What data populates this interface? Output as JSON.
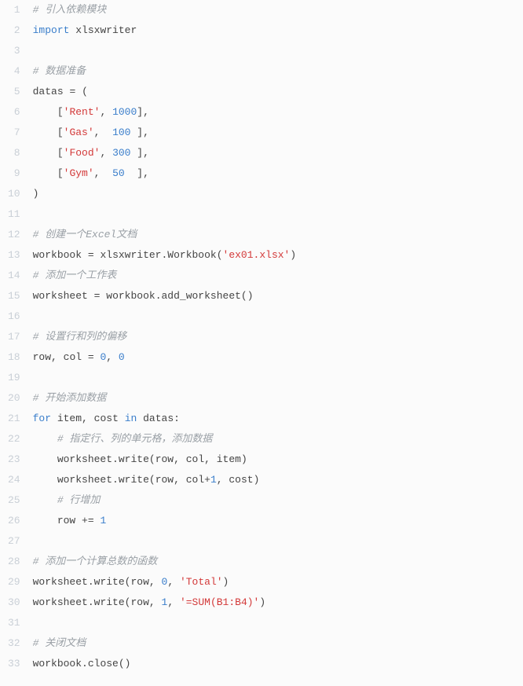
{
  "code": {
    "lines": [
      {
        "n": "1",
        "tokens": [
          {
            "cls": "tok-comment",
            "t": "# 引入依赖模块"
          }
        ]
      },
      {
        "n": "2",
        "tokens": [
          {
            "cls": "tok-keyword",
            "t": "import"
          },
          {
            "cls": "tok-default",
            "t": " "
          },
          {
            "cls": "tok-name",
            "t": "xlsxwriter"
          }
        ]
      },
      {
        "n": "3",
        "tokens": []
      },
      {
        "n": "4",
        "tokens": [
          {
            "cls": "tok-comment",
            "t": "# 数据准备"
          }
        ]
      },
      {
        "n": "5",
        "tokens": [
          {
            "cls": "tok-name",
            "t": "datas"
          },
          {
            "cls": "tok-default",
            "t": " "
          },
          {
            "cls": "tok-punc",
            "t": "="
          },
          {
            "cls": "tok-default",
            "t": " "
          },
          {
            "cls": "tok-punc",
            "t": "("
          }
        ]
      },
      {
        "n": "6",
        "tokens": [
          {
            "cls": "tok-default",
            "t": "    "
          },
          {
            "cls": "tok-punc",
            "t": "["
          },
          {
            "cls": "tok-string",
            "t": "'Rent'"
          },
          {
            "cls": "tok-punc",
            "t": ","
          },
          {
            "cls": "tok-default",
            "t": " "
          },
          {
            "cls": "tok-number",
            "t": "1000"
          },
          {
            "cls": "tok-punc",
            "t": "]"
          },
          {
            "cls": "tok-punc",
            "t": ","
          }
        ]
      },
      {
        "n": "7",
        "tokens": [
          {
            "cls": "tok-default",
            "t": "    "
          },
          {
            "cls": "tok-punc",
            "t": "["
          },
          {
            "cls": "tok-string",
            "t": "'Gas'"
          },
          {
            "cls": "tok-punc",
            "t": ","
          },
          {
            "cls": "tok-default",
            "t": "  "
          },
          {
            "cls": "tok-number",
            "t": "100"
          },
          {
            "cls": "tok-default",
            "t": " "
          },
          {
            "cls": "tok-punc",
            "t": "]"
          },
          {
            "cls": "tok-punc",
            "t": ","
          }
        ]
      },
      {
        "n": "8",
        "tokens": [
          {
            "cls": "tok-default",
            "t": "    "
          },
          {
            "cls": "tok-punc",
            "t": "["
          },
          {
            "cls": "tok-string",
            "t": "'Food'"
          },
          {
            "cls": "tok-punc",
            "t": ","
          },
          {
            "cls": "tok-default",
            "t": " "
          },
          {
            "cls": "tok-number",
            "t": "300"
          },
          {
            "cls": "tok-default",
            "t": " "
          },
          {
            "cls": "tok-punc",
            "t": "]"
          },
          {
            "cls": "tok-punc",
            "t": ","
          }
        ]
      },
      {
        "n": "9",
        "tokens": [
          {
            "cls": "tok-default",
            "t": "    "
          },
          {
            "cls": "tok-punc",
            "t": "["
          },
          {
            "cls": "tok-string",
            "t": "'Gym'"
          },
          {
            "cls": "tok-punc",
            "t": ","
          },
          {
            "cls": "tok-default",
            "t": "  "
          },
          {
            "cls": "tok-number",
            "t": "50"
          },
          {
            "cls": "tok-default",
            "t": "  "
          },
          {
            "cls": "tok-punc",
            "t": "]"
          },
          {
            "cls": "tok-punc",
            "t": ","
          }
        ]
      },
      {
        "n": "10",
        "tokens": [
          {
            "cls": "tok-punc",
            "t": ")"
          }
        ]
      },
      {
        "n": "11",
        "tokens": []
      },
      {
        "n": "12",
        "tokens": [
          {
            "cls": "tok-comment",
            "t": "# 创建一个Excel文档"
          }
        ]
      },
      {
        "n": "13",
        "tokens": [
          {
            "cls": "tok-name",
            "t": "workbook"
          },
          {
            "cls": "tok-default",
            "t": " "
          },
          {
            "cls": "tok-punc",
            "t": "="
          },
          {
            "cls": "tok-default",
            "t": " "
          },
          {
            "cls": "tok-name",
            "t": "xlsxwriter"
          },
          {
            "cls": "tok-punc",
            "t": "."
          },
          {
            "cls": "tok-name",
            "t": "Workbook"
          },
          {
            "cls": "tok-punc",
            "t": "("
          },
          {
            "cls": "tok-string",
            "t": "'ex01.xlsx'"
          },
          {
            "cls": "tok-punc",
            "t": ")"
          }
        ]
      },
      {
        "n": "14",
        "tokens": [
          {
            "cls": "tok-comment",
            "t": "# 添加一个工作表"
          }
        ]
      },
      {
        "n": "15",
        "tokens": [
          {
            "cls": "tok-name",
            "t": "worksheet"
          },
          {
            "cls": "tok-default",
            "t": " "
          },
          {
            "cls": "tok-punc",
            "t": "="
          },
          {
            "cls": "tok-default",
            "t": " "
          },
          {
            "cls": "tok-name",
            "t": "workbook"
          },
          {
            "cls": "tok-punc",
            "t": "."
          },
          {
            "cls": "tok-name",
            "t": "add_worksheet"
          },
          {
            "cls": "tok-punc",
            "t": "()"
          }
        ]
      },
      {
        "n": "16",
        "tokens": []
      },
      {
        "n": "17",
        "tokens": [
          {
            "cls": "tok-comment",
            "t": "# 设置行和列的偏移"
          }
        ]
      },
      {
        "n": "18",
        "tokens": [
          {
            "cls": "tok-name",
            "t": "row"
          },
          {
            "cls": "tok-punc",
            "t": ","
          },
          {
            "cls": "tok-default",
            "t": " "
          },
          {
            "cls": "tok-name",
            "t": "col"
          },
          {
            "cls": "tok-default",
            "t": " "
          },
          {
            "cls": "tok-punc",
            "t": "="
          },
          {
            "cls": "tok-default",
            "t": " "
          },
          {
            "cls": "tok-number",
            "t": "0"
          },
          {
            "cls": "tok-punc",
            "t": ","
          },
          {
            "cls": "tok-default",
            "t": " "
          },
          {
            "cls": "tok-number",
            "t": "0"
          }
        ]
      },
      {
        "n": "19",
        "tokens": []
      },
      {
        "n": "20",
        "tokens": [
          {
            "cls": "tok-comment",
            "t": "# 开始添加数据"
          }
        ]
      },
      {
        "n": "21",
        "tokens": [
          {
            "cls": "tok-keyword",
            "t": "for"
          },
          {
            "cls": "tok-default",
            "t": " "
          },
          {
            "cls": "tok-name",
            "t": "item"
          },
          {
            "cls": "tok-punc",
            "t": ","
          },
          {
            "cls": "tok-default",
            "t": " "
          },
          {
            "cls": "tok-name",
            "t": "cost"
          },
          {
            "cls": "tok-default",
            "t": " "
          },
          {
            "cls": "tok-keyword",
            "t": "in"
          },
          {
            "cls": "tok-default",
            "t": " "
          },
          {
            "cls": "tok-name",
            "t": "datas"
          },
          {
            "cls": "tok-punc",
            "t": ":"
          }
        ]
      },
      {
        "n": "22",
        "tokens": [
          {
            "cls": "tok-default",
            "t": "    "
          },
          {
            "cls": "tok-comment",
            "t": "# 指定行、列的单元格，添加数据"
          }
        ]
      },
      {
        "n": "23",
        "tokens": [
          {
            "cls": "tok-default",
            "t": "    "
          },
          {
            "cls": "tok-name",
            "t": "worksheet"
          },
          {
            "cls": "tok-punc",
            "t": "."
          },
          {
            "cls": "tok-name",
            "t": "write"
          },
          {
            "cls": "tok-punc",
            "t": "("
          },
          {
            "cls": "tok-name",
            "t": "row"
          },
          {
            "cls": "tok-punc",
            "t": ","
          },
          {
            "cls": "tok-default",
            "t": " "
          },
          {
            "cls": "tok-name",
            "t": "col"
          },
          {
            "cls": "tok-punc",
            "t": ","
          },
          {
            "cls": "tok-default",
            "t": " "
          },
          {
            "cls": "tok-name",
            "t": "item"
          },
          {
            "cls": "tok-punc",
            "t": ")"
          }
        ]
      },
      {
        "n": "24",
        "tokens": [
          {
            "cls": "tok-default",
            "t": "    "
          },
          {
            "cls": "tok-name",
            "t": "worksheet"
          },
          {
            "cls": "tok-punc",
            "t": "."
          },
          {
            "cls": "tok-name",
            "t": "write"
          },
          {
            "cls": "tok-punc",
            "t": "("
          },
          {
            "cls": "tok-name",
            "t": "row"
          },
          {
            "cls": "tok-punc",
            "t": ","
          },
          {
            "cls": "tok-default",
            "t": " "
          },
          {
            "cls": "tok-name",
            "t": "col"
          },
          {
            "cls": "tok-punc",
            "t": "+"
          },
          {
            "cls": "tok-number",
            "t": "1"
          },
          {
            "cls": "tok-punc",
            "t": ","
          },
          {
            "cls": "tok-default",
            "t": " "
          },
          {
            "cls": "tok-name",
            "t": "cost"
          },
          {
            "cls": "tok-punc",
            "t": ")"
          }
        ]
      },
      {
        "n": "25",
        "tokens": [
          {
            "cls": "tok-default",
            "t": "    "
          },
          {
            "cls": "tok-comment",
            "t": "# 行增加"
          }
        ]
      },
      {
        "n": "26",
        "tokens": [
          {
            "cls": "tok-default",
            "t": "    "
          },
          {
            "cls": "tok-name",
            "t": "row"
          },
          {
            "cls": "tok-default",
            "t": " "
          },
          {
            "cls": "tok-punc",
            "t": "+="
          },
          {
            "cls": "tok-default",
            "t": " "
          },
          {
            "cls": "tok-number",
            "t": "1"
          }
        ]
      },
      {
        "n": "27",
        "tokens": []
      },
      {
        "n": "28",
        "tokens": [
          {
            "cls": "tok-comment",
            "t": "# 添加一个计算总数的函数"
          }
        ]
      },
      {
        "n": "29",
        "tokens": [
          {
            "cls": "tok-name",
            "t": "worksheet"
          },
          {
            "cls": "tok-punc",
            "t": "."
          },
          {
            "cls": "tok-name",
            "t": "write"
          },
          {
            "cls": "tok-punc",
            "t": "("
          },
          {
            "cls": "tok-name",
            "t": "row"
          },
          {
            "cls": "tok-punc",
            "t": ","
          },
          {
            "cls": "tok-default",
            "t": " "
          },
          {
            "cls": "tok-number",
            "t": "0"
          },
          {
            "cls": "tok-punc",
            "t": ","
          },
          {
            "cls": "tok-default",
            "t": " "
          },
          {
            "cls": "tok-string",
            "t": "'Total'"
          },
          {
            "cls": "tok-punc",
            "t": ")"
          }
        ]
      },
      {
        "n": "30",
        "tokens": [
          {
            "cls": "tok-name",
            "t": "worksheet"
          },
          {
            "cls": "tok-punc",
            "t": "."
          },
          {
            "cls": "tok-name",
            "t": "write"
          },
          {
            "cls": "tok-punc",
            "t": "("
          },
          {
            "cls": "tok-name",
            "t": "row"
          },
          {
            "cls": "tok-punc",
            "t": ","
          },
          {
            "cls": "tok-default",
            "t": " "
          },
          {
            "cls": "tok-number",
            "t": "1"
          },
          {
            "cls": "tok-punc",
            "t": ","
          },
          {
            "cls": "tok-default",
            "t": " "
          },
          {
            "cls": "tok-string",
            "t": "'=SUM(B1:B4)'"
          },
          {
            "cls": "tok-punc",
            "t": ")"
          }
        ]
      },
      {
        "n": "31",
        "tokens": []
      },
      {
        "n": "32",
        "tokens": [
          {
            "cls": "tok-comment",
            "t": "# 关闭文档"
          }
        ]
      },
      {
        "n": "33",
        "tokens": [
          {
            "cls": "tok-name",
            "t": "workbook"
          },
          {
            "cls": "tok-punc",
            "t": "."
          },
          {
            "cls": "tok-name",
            "t": "close"
          },
          {
            "cls": "tok-punc",
            "t": "()"
          }
        ]
      }
    ]
  }
}
